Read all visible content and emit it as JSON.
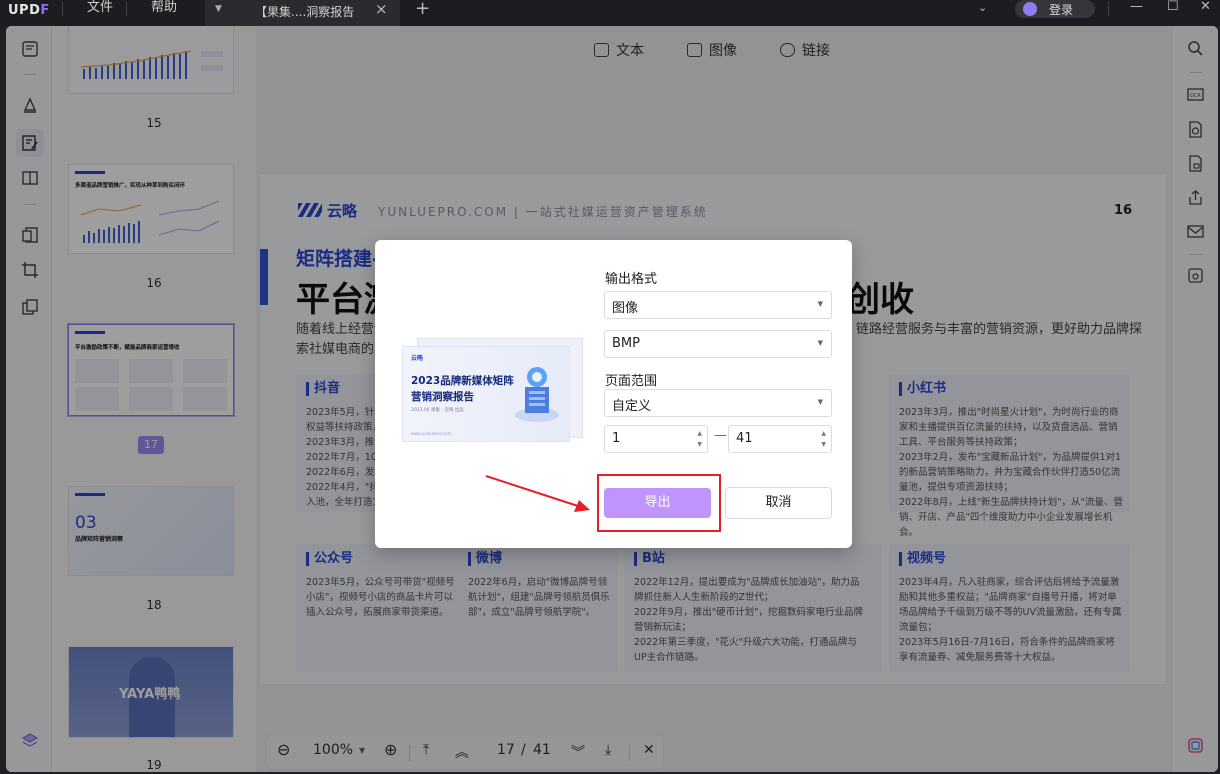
{
  "titlebar": {
    "logo": "UPDF",
    "menu": [
      "文件",
      "帮助"
    ],
    "tab_title": "【果集....洞察报告",
    "login_label": "登录"
  },
  "edit_toolbar": {
    "text_label": "文本",
    "image_label": "图像",
    "link_label": "链接"
  },
  "thumbnails": [
    {
      "page": "15",
      "chart": true
    },
    {
      "page": "16",
      "headline": "多渠道品牌营销推广，实现从种草到购买闭环"
    },
    {
      "page": "17",
      "headline": "平台激励政策不断，赋能品牌商家运营增收",
      "selected": true
    },
    {
      "page": "18",
      "section": "03",
      "headline": "品牌矩阵营销洞察"
    },
    {
      "page": "19",
      "cover_text": "YAYA鸭鸭"
    }
  ],
  "page": {
    "brand": "云略",
    "tagline": "YUNLUEPRO.COM  |  一站式社媒运营资产管理系统",
    "number": "16",
    "subtitle": "矩阵搭建-",
    "title_left": "平台激",
    "title_right": "创收",
    "intro_left_1": "随着线上经营逻",
    "intro_left_2": "索社媒电商的发",
    "intro_right": "链路经营服务与丰富的营销资源，更好助力品牌探",
    "cards": [
      {
        "name": "抖音",
        "text": "2023年5月，针对\n权益等扶持政策，\n2023年3月，推出\n2022年7月，10月\n2022年6月，发布\n2022年4月，\"抖\n入池，全年打造10"
      },
      {
        "name": "小红书",
        "text": "2023年3月，推出\"时尚星火计划\"，为时尚行业的商家和主播提供百亿流量的扶持，以及货盘选品、营销工具、平台服务等扶持政策；\n2023年2月，发布\"宝藏新品计划\"，为品牌提供1对1的新品营销策略助力，并为宝藏合作伙伴打造50亿流量池，提供专项资源扶持；\n2022年8月，上线\"新生品牌扶持计划\"，从\"流量、营销、开店、产品\"四个维度助力中小企业发展增长机会。"
      },
      {
        "name": "公众号",
        "text": "2023年5月，公众号可带货\"视频号小店\"，视频号小店的商品卡片可以插入公众号，拓展商家带货渠道。"
      },
      {
        "name": "微博",
        "text": "2022年6月，启动\"微博品牌号领航计划\"，组建\"品牌号领航员俱乐部\"，成立\"品牌号领航学院\"。"
      },
      {
        "name": "B站",
        "text": "2022年12月，提出要成为\"品牌成长加油站\"，助力品牌抓住新人人生新阶段的Z世代；\n2022年9月，推出\"硬币计划\"，挖掘数码家电行业品牌营销新玩法；\n2022年第三季度，\"花火\"升级六大功能，打通品牌与UP主合作链路。"
      },
      {
        "name": "视频号",
        "text": "2023年4月，凡入驻商家，综合评估后将给予流量激励和其他多重权益；\"品牌商家\"自播号开播，将对单场品牌给予千级到万级不等的UV流量激励，还有专属流量包；\n2023年5月16日-7月16日，符合条件的品牌商家将享有流量券、减免服务费等十大权益。"
      }
    ]
  },
  "bottom_bar": {
    "zoom": "100%",
    "current_page": "17",
    "separator": "/",
    "total_pages": "41"
  },
  "dialog": {
    "preview_logo": "云略",
    "preview_title_1": "2023品牌新媒体矩阵",
    "preview_title_2": "营销洞察报告",
    "preview_sub": "2023.06 果集 · 云略 出品",
    "preview_url": "www.yunluepro.com",
    "format_label": "输出格式",
    "format_value": "图像",
    "image_type_value": "BMP",
    "range_label": "页面范围",
    "range_value": "自定义",
    "from_value": "1",
    "range_separator": "—",
    "to_value": "41",
    "export_label": "导出",
    "cancel_label": "取消"
  },
  "colors": {
    "accent": "#bf94fb",
    "brand_blue": "#2b48d6",
    "highlight_red": "#e3202a"
  }
}
